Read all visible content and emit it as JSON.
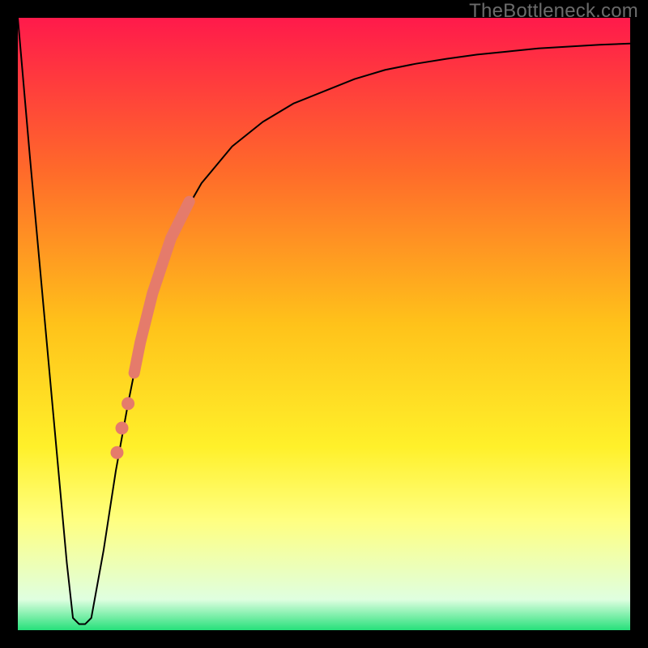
{
  "watermark": "TheBottleneck.com",
  "chart_data": {
    "type": "line",
    "title": "",
    "xlabel": "",
    "ylabel": "",
    "xlim": [
      0,
      100
    ],
    "ylim": [
      0,
      100
    ],
    "grid": false,
    "axes_visible": false,
    "background_gradient": {
      "stops": [
        {
          "pos": 0.0,
          "color": "#ff1a4b"
        },
        {
          "pos": 0.25,
          "color": "#ff6a2a"
        },
        {
          "pos": 0.5,
          "color": "#ffc21a"
        },
        {
          "pos": 0.7,
          "color": "#fff02a"
        },
        {
          "pos": 0.82,
          "color": "#ffff80"
        },
        {
          "pos": 0.95,
          "color": "#dfffe0"
        },
        {
          "pos": 1.0,
          "color": "#26e07a"
        }
      ]
    },
    "series": [
      {
        "name": "bottleneck-curve",
        "stroke": "#000000",
        "stroke_width": 2,
        "x": [
          0,
          2,
          4,
          6,
          8,
          9,
          10,
          11,
          12,
          14,
          16,
          18,
          20,
          22,
          24,
          26,
          30,
          35,
          40,
          45,
          50,
          55,
          60,
          65,
          70,
          75,
          80,
          85,
          90,
          95,
          100
        ],
        "y": [
          100,
          77,
          55,
          33,
          11,
          2,
          1,
          1,
          2,
          13,
          26,
          37,
          47,
          55,
          61,
          66,
          73,
          79,
          83,
          86,
          88,
          90,
          91.5,
          92.5,
          93.3,
          94,
          94.5,
          95,
          95.3,
          95.6,
          95.8
        ]
      }
    ],
    "highlight_segment": {
      "name": "highlight-band",
      "color": "#e57b6b",
      "width": 14,
      "x": [
        19,
        20,
        21,
        22,
        23,
        24,
        25,
        26,
        27,
        28
      ],
      "y": [
        42,
        47,
        51,
        55,
        58,
        61,
        64,
        66,
        68,
        70
      ]
    },
    "highlight_dots": {
      "name": "highlight-dots",
      "color": "#e57b6b",
      "r": 8,
      "points": [
        {
          "x": 18.0,
          "y": 37
        },
        {
          "x": 17.0,
          "y": 33
        },
        {
          "x": 16.2,
          "y": 29
        }
      ]
    }
  }
}
